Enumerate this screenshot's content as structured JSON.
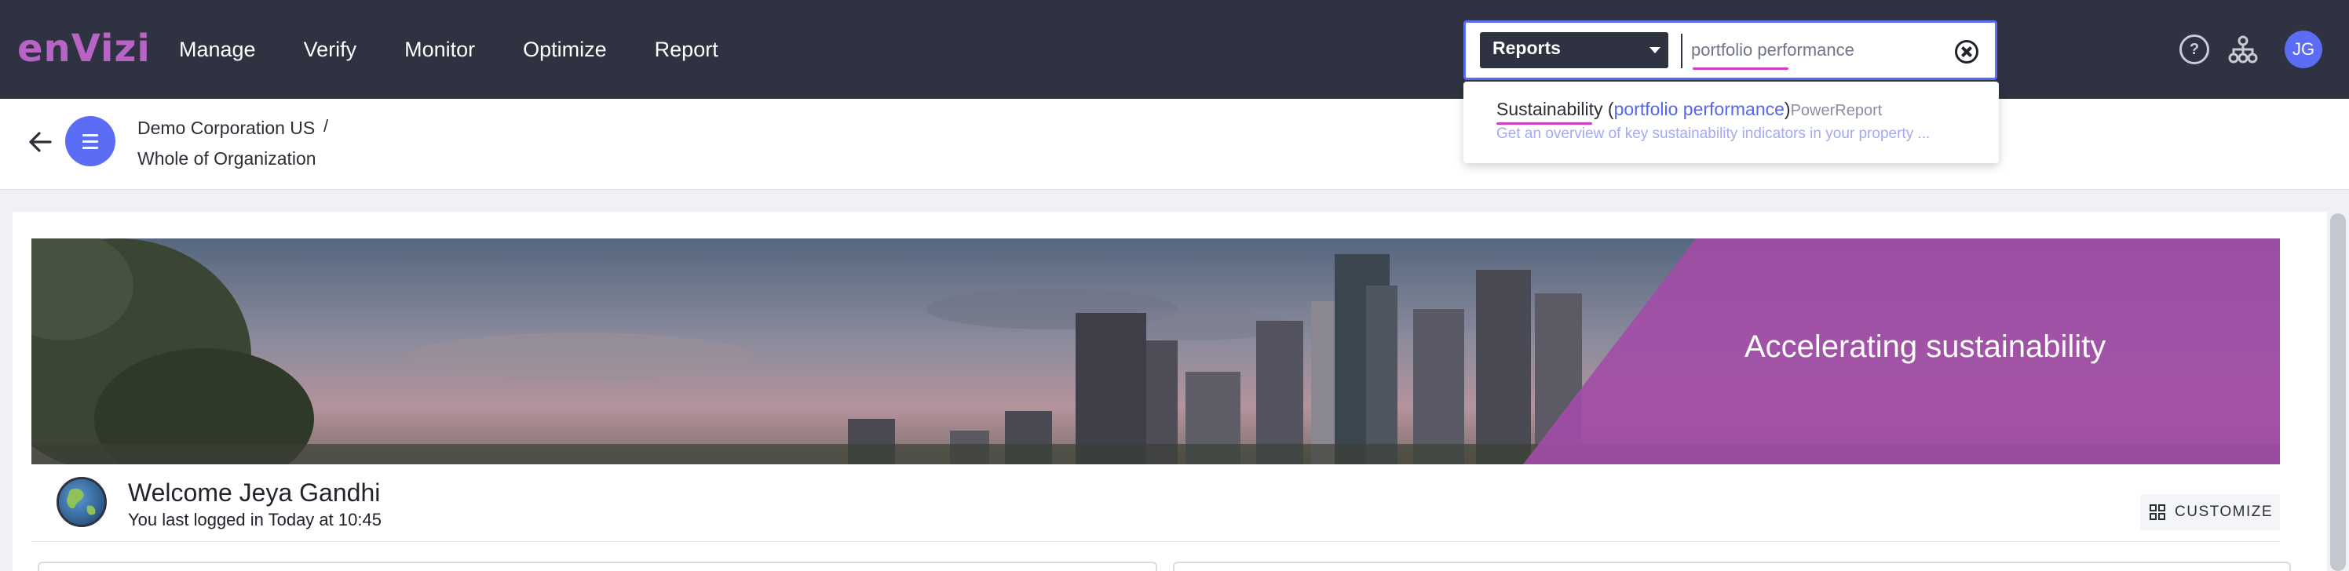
{
  "app": {
    "logo_text": "enVizi",
    "brand_color": "#b864c6",
    "accent_color": "#5b6df5"
  },
  "nav": {
    "items": [
      "Manage",
      "Verify",
      "Monitor",
      "Optimize",
      "Report"
    ]
  },
  "search": {
    "scope_selected": "Reports",
    "query": "portfolio performance",
    "clear_icon": "close-circle-icon"
  },
  "header_icons": {
    "help": "help-icon",
    "org": "hierarchy-icon",
    "avatar_initials": "JG"
  },
  "breadcrumb": {
    "organization": "Demo Corporation US",
    "separator": "/",
    "scope": "Whole of Organization"
  },
  "search_results": [
    {
      "title_prefix": "Sustainability (",
      "title_match": "portfolio performance",
      "title_suffix": ")",
      "type": "PowerReport",
      "description": "Get an overview of key sustainability indicators in your property ..."
    }
  ],
  "banner": {
    "text": "Accelerating sustainability"
  },
  "welcome": {
    "title": "Welcome Jeya Gandhi",
    "last_login": "You last logged in Today at 10:45"
  },
  "toolbar": {
    "customize_label": "CUSTOMIZE"
  }
}
